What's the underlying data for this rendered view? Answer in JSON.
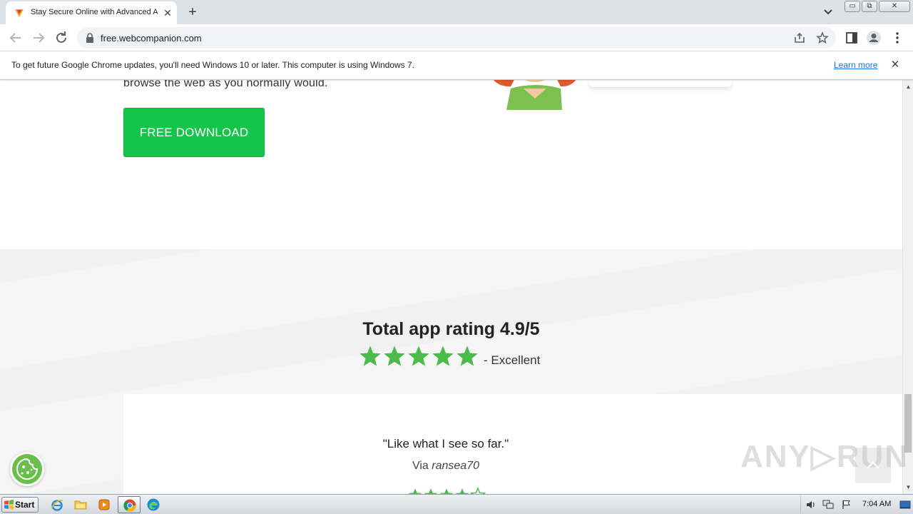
{
  "browser": {
    "tab_title": "Stay Secure Online with Advanced A",
    "url": "free.webcompanion.com",
    "window_controls": {
      "minimize": "▭",
      "restore": "⧉",
      "close": "✕"
    }
  },
  "infobar": {
    "message": "To get future Google Chrome updates, you'll need Windows 10 or later. This computer is using Windows 7.",
    "link": "Learn more"
  },
  "page": {
    "hero_text": "browse the web as you normally would.",
    "download_button": "FREE DOWNLOAD",
    "rating_title": "Total app rating 4.9/5",
    "rating_label": "- Excellent",
    "review_quote": "\"Like what I see so far.\"",
    "review_via": "Via",
    "review_author": "ransea70",
    "watermark": "ANY▷RUN",
    "colors": {
      "accent_green": "#14c54a",
      "star_green": "#4cbb4c",
      "cookie_green": "#6abf4b"
    }
  },
  "taskbar": {
    "start_label": "Start",
    "clock": "7:04 AM"
  },
  "icons": [
    "webcompanion-favicon-icon",
    "close-icon",
    "plus-icon",
    "chevron-down-icon",
    "back-arrow-icon",
    "forward-arrow-icon",
    "reload-icon",
    "lock-icon",
    "share-icon",
    "star-outline-icon",
    "side-panel-icon",
    "profile-icon",
    "kebab-menu-icon",
    "cookie-icon",
    "chevron-up-icon",
    "windows-flag-icon",
    "internet-explorer-icon",
    "folder-icon",
    "media-player-icon",
    "chrome-icon",
    "edge-icon",
    "volume-icon",
    "network-icon",
    "action-center-flag-icon",
    "show-desktop-icon"
  ]
}
